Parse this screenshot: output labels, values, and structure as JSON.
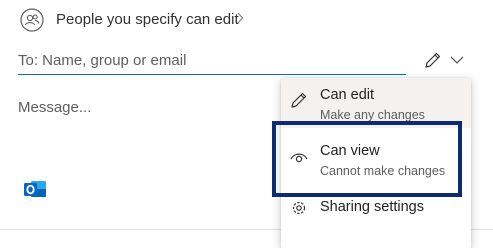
{
  "header": {
    "permission_label": "People you specify can edit"
  },
  "to_field": {
    "placeholder": "To: Name, group or email"
  },
  "message_field": {
    "placeholder": "Message..."
  },
  "permission_menu": {
    "items": [
      {
        "title": "Can edit",
        "subtitle": "Make any changes",
        "icon": "pencil-icon"
      },
      {
        "title": "Can view",
        "subtitle": "Cannot make changes",
        "icon": "eye-icon"
      },
      {
        "title": "Sharing settings",
        "subtitle": "",
        "icon": "gear-icon"
      }
    ]
  },
  "colors": {
    "accent": "#0f6cbd",
    "highlight_border": "#0c2b73",
    "outlook_blue": "#0a64c4"
  }
}
